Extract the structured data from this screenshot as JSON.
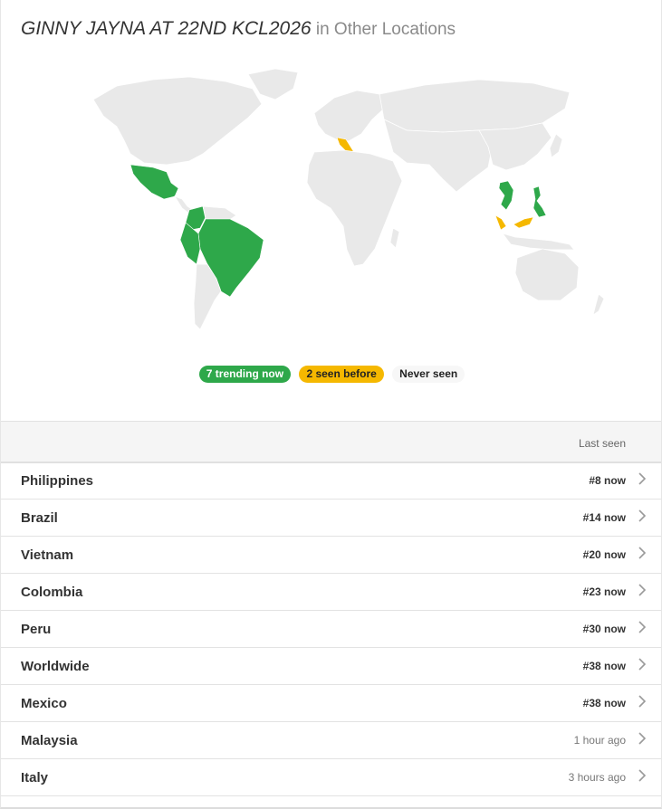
{
  "header": {
    "trend_name": "GINNY JAYNA AT 22ND KCL2026",
    "suffix": " in Other Locations"
  },
  "legend": {
    "trending": "7 trending now",
    "seen_before": "2 seen before",
    "never_seen": "Never seen"
  },
  "colors": {
    "trending": "#2ea84a",
    "seen_before": "#f5b800",
    "never_seen": "#e9e9e9"
  },
  "table": {
    "column_header": "Last seen",
    "rows": [
      {
        "name": "Philippines",
        "seen": "#8 now"
      },
      {
        "name": "Brazil",
        "seen": "#14 now"
      },
      {
        "name": "Vietnam",
        "seen": "#20 now"
      },
      {
        "name": "Colombia",
        "seen": "#23 now"
      },
      {
        "name": "Peru",
        "seen": "#30 now"
      },
      {
        "name": "Worldwide",
        "seen": "#38 now"
      },
      {
        "name": "Mexico",
        "seen": "#38 now"
      },
      {
        "name": "Malaysia",
        "seen": "1 hour ago"
      },
      {
        "name": "Italy",
        "seen": "3 hours ago"
      }
    ]
  }
}
